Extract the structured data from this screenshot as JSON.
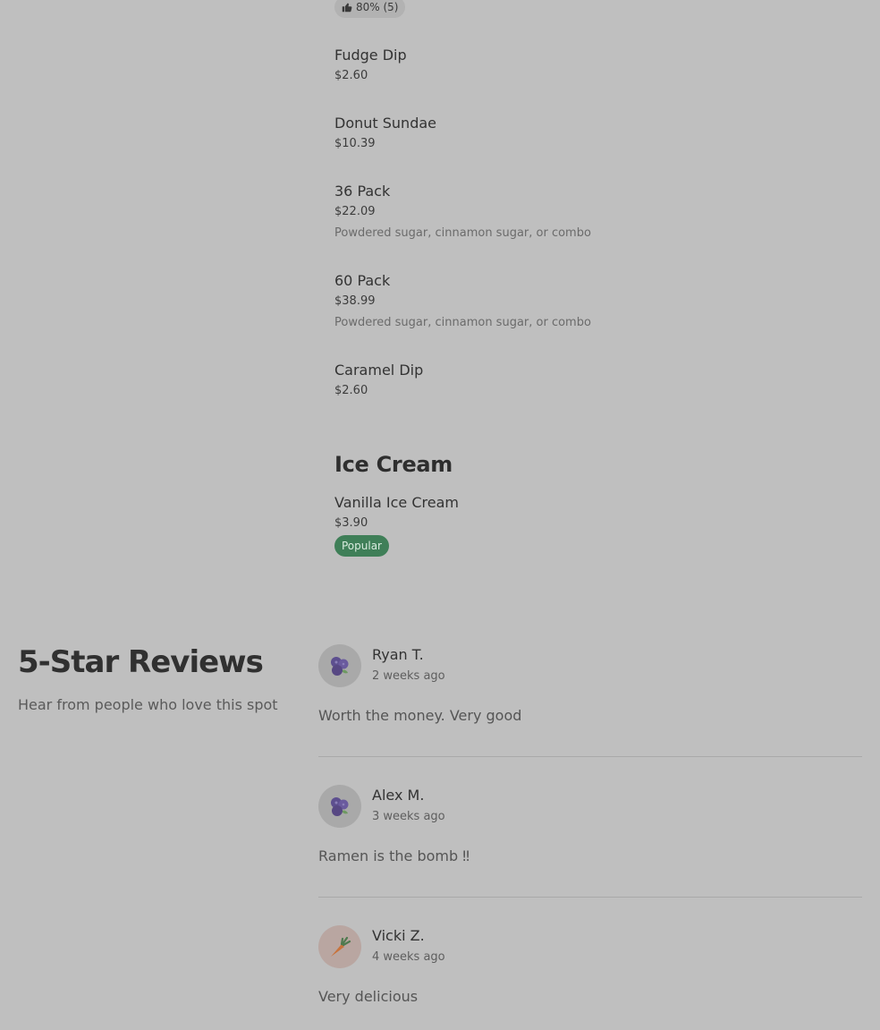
{
  "menu": {
    "rating_badge": {
      "icon": "thumbs-up-icon",
      "text": "80% (5)"
    },
    "items_top": [
      {
        "name": "Fudge Dip",
        "price": "$2.60"
      },
      {
        "name": "Donut Sundae",
        "price": "$10.39"
      },
      {
        "name": "36 Pack",
        "price": "$22.09",
        "description": "Powdered sugar, cinnamon sugar, or combo"
      },
      {
        "name": "60 Pack",
        "price": "$38.99",
        "description": "Powdered sugar, cinnamon sugar, or combo"
      },
      {
        "name": "Caramel Dip",
        "price": "$2.60"
      }
    ],
    "section_ice_cream": {
      "heading": "Ice Cream",
      "items": [
        {
          "name": "Vanilla Ice Cream",
          "price": "$3.90",
          "badge": "Popular"
        }
      ]
    }
  },
  "reviews": {
    "title": "5-Star Reviews",
    "subtitle": "Hear from people who love this spot",
    "list": [
      {
        "name": "Ryan T.",
        "date": "2 weeks ago",
        "text": "Worth the money. Very good",
        "avatar": "blueberry-icon"
      },
      {
        "name": "Alex M.",
        "date": "3 weeks ago",
        "text": "Ramen is the bomb ‼",
        "avatar": "blueberry-icon"
      },
      {
        "name": "Vicki Z.",
        "date": "4 weeks ago",
        "text": "Very delicious",
        "avatar": "carrot-icon"
      }
    ]
  },
  "colors": {
    "background": "#bfbfbf",
    "popular_badge": "#3f7f58",
    "rating_badge": "#b2b2b2",
    "avatar_bg": "#a9a9a9"
  }
}
